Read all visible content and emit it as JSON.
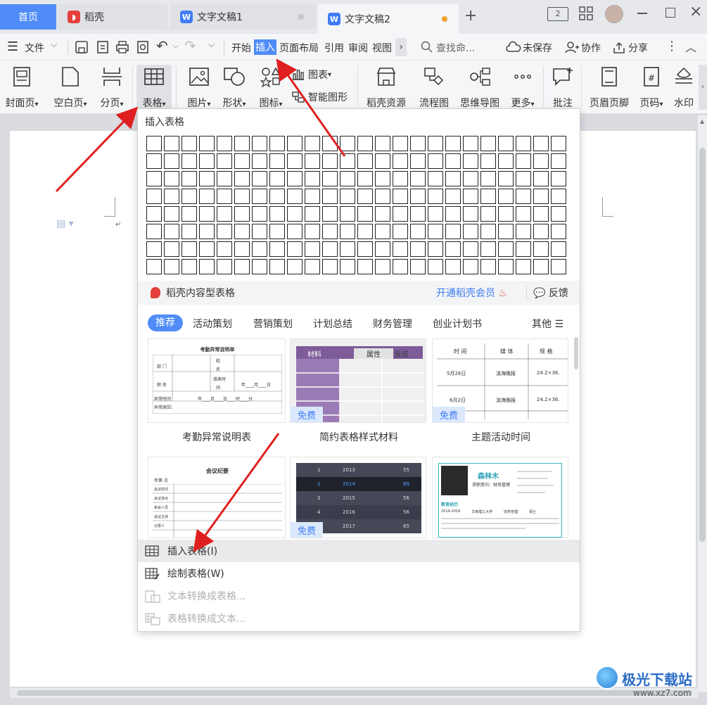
{
  "tabs": {
    "home": "首页",
    "daoke": "稻壳",
    "doc1": "文字文稿1",
    "doc2": "文字文稿2"
  },
  "menubar": {
    "file": "文件",
    "tabs": [
      "开始",
      "插入",
      "页面布局",
      "引用",
      "审阅",
      "视图"
    ],
    "search_placeholder": "查找命...",
    "unsaved": "未保存",
    "collab": "协作",
    "share": "分享"
  },
  "ribbon": {
    "cover": "封面页",
    "blank": "空白页",
    "pagebreak": "分页",
    "table": "表格",
    "picture": "图片",
    "shape": "形状",
    "iconlib": "图标",
    "chart": "图表",
    "smartart": "智能图形",
    "daoke_res": "稻壳资源",
    "flowchart": "流程图",
    "mindmap": "思维导图",
    "more": "更多",
    "comment": "批注",
    "header_footer": "页眉页脚",
    "page_number": "页码",
    "watermark": "水印"
  },
  "dropdown": {
    "title": "插入表格",
    "daoke_tables": "稻壳内容型表格",
    "vip": "开通稻壳会员",
    "feedback": "反馈",
    "categories": [
      "推荐",
      "活动策划",
      "营销策划",
      "计划总结",
      "财务管理",
      "创业计划书"
    ],
    "other": "其他",
    "free_badge": "免费",
    "templates": [
      {
        "name": "考勤异常说明表"
      },
      {
        "name": "简约表格样式材料"
      },
      {
        "name": "主题活动时间"
      }
    ],
    "t1": {
      "title": "考勤异常说明单",
      "dept": "部 门",
      "name": "姓",
      "name2": "名",
      "job": "职 务",
      "fill_time": "填表时",
      "fill_time2": "间",
      "date": "年____月____日",
      "abn_time": "异常时间",
      "abn_range": "年____月____日____时____分",
      "abn_reason": "异常原因："
    },
    "t2": {
      "headers": [
        "材料",
        "属性",
        "反应"
      ]
    },
    "t3": {
      "headers": [
        "时 间",
        "媒 体",
        "规 格"
      ],
      "rows": [
        [
          "5月26日",
          "滨海晚报",
          "24.2×36."
        ],
        [
          "6月2日",
          "滨海晚报",
          "24.2×36."
        ]
      ]
    },
    "t4": {
      "title": "会议纪要",
      "rows": [
        "年第 次",
        "会议时间",
        "会议地点",
        "参会人员",
        "会议主持",
        "记录人"
      ]
    },
    "t5": {
      "rows": [
        [
          "1",
          "2013",
          "55"
        ],
        [
          "2",
          "2014",
          "89"
        ],
        [
          "3",
          "2015",
          "56"
        ],
        [
          "4",
          "2016",
          "56"
        ],
        [
          "5",
          "2017",
          "65"
        ]
      ]
    },
    "t6": {
      "name": "森林木",
      "intent": "求职意向：财务管理",
      "section": "教育经历",
      "edu": "2014-2016",
      "school": "华南理工大学",
      "major": "财务管理",
      "degree": "硕士"
    },
    "menu": {
      "insert": "插入表格(I)",
      "draw": "绘制表格(W)",
      "text_to_table": "文本转换成表格...",
      "table_to_text": "表格转换成文本..."
    }
  },
  "watermark": {
    "site": "极光下载站",
    "url": "www.xz7.com"
  },
  "colors": {
    "accent": "#4f8cf7",
    "arrow": "#e02020",
    "purple": "#9b7bb5"
  }
}
